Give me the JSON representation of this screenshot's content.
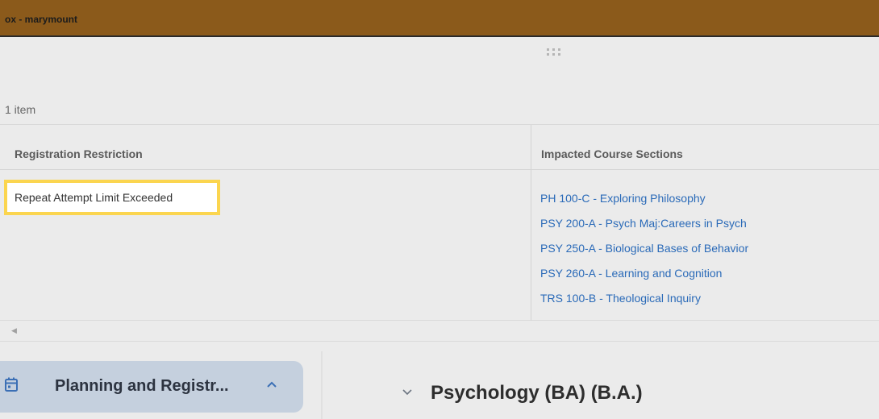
{
  "topbar": {
    "title": "ox - marymount"
  },
  "table": {
    "count_label": "1 item",
    "headers": [
      "Registration Restriction",
      "Impacted Course Sections"
    ],
    "restriction": "Repeat Attempt Limit Exceeded",
    "course_sections": [
      "PH 100-C - Exploring Philosophy",
      "PSY 200-A - Psych Maj:Careers in Psych",
      "PSY 250-A - Biological Bases of Behavior",
      "PSY 260-A - Learning and Cognition",
      "TRS 100-B - Theological Inquiry"
    ]
  },
  "sidebar": {
    "section_label": "Planning and Registr...",
    "icon": "calendar-icon",
    "highlight_color": "#c5d0de"
  },
  "main": {
    "program_title": "Psychology (BA) (B.A.)"
  },
  "colors": {
    "topbar": "#8b5a1b",
    "link": "#2a6ab8",
    "highlight_border": "#fbd54f"
  }
}
